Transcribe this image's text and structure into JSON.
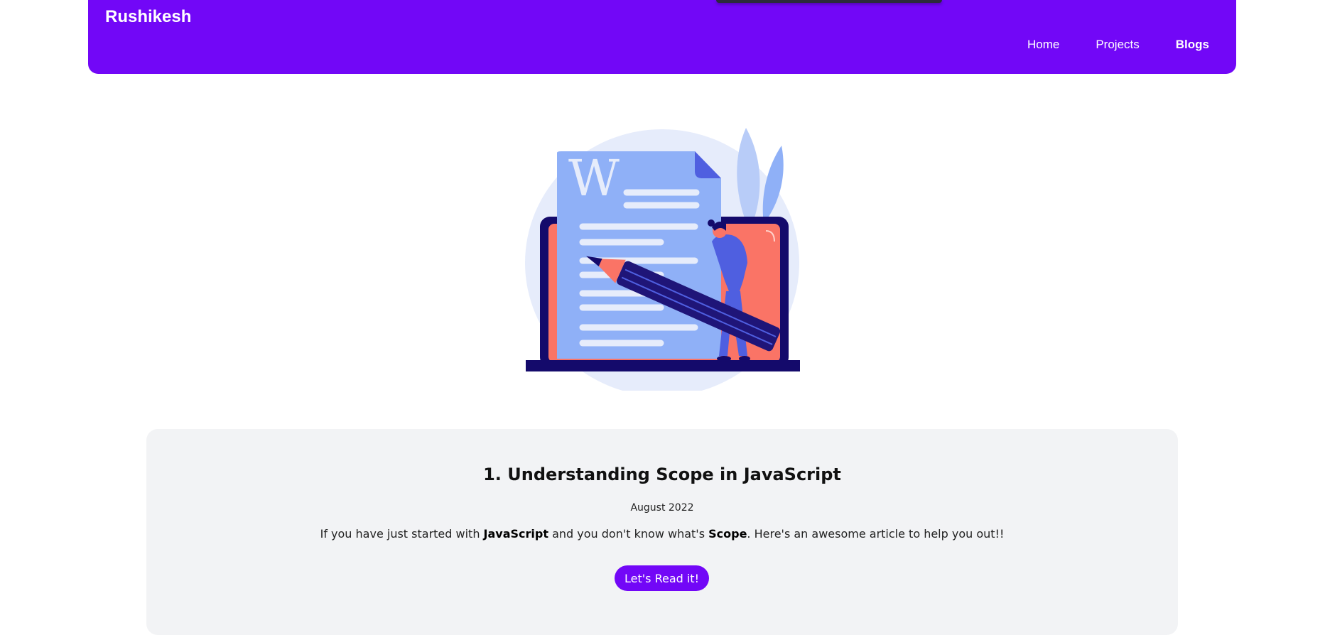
{
  "navbar": {
    "brand": "Rushikesh",
    "links": [
      {
        "label": "Home",
        "active": false
      },
      {
        "label": "Projects",
        "active": false
      },
      {
        "label": "Blogs",
        "active": true
      }
    ]
  },
  "hero": {
    "image_icon": "blog-writing-illustration",
    "doc_letter": "W"
  },
  "blog_posts": [
    {
      "title": "1. Understanding Scope in JavaScript",
      "date": "August 2022",
      "desc_part1": "If you have just started with ",
      "desc_bold1": "JavaScript",
      "desc_part2": " and you don't know what's ",
      "desc_bold2": "Scope",
      "desc_part3": ". Here's an awesome article to help you out!!",
      "button_label": "Let's Read it!"
    }
  ],
  "colors": {
    "brand_purple": "#7207f7",
    "card_bg": "#f2f3f5",
    "illustration_blue": "#8fb0f7",
    "illustration_coral": "#fa7466",
    "illustration_navy": "#140a6b"
  }
}
